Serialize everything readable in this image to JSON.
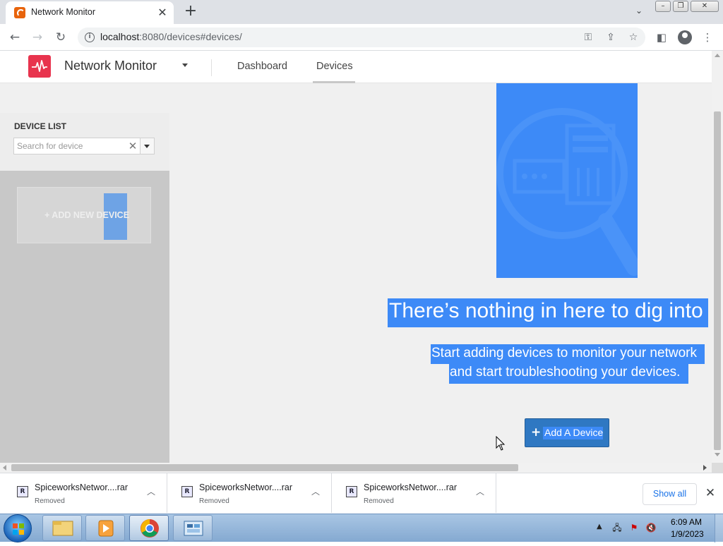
{
  "browser": {
    "tab_title": "Network Monitor",
    "url_host": "localhost",
    "url_rest": ":8080/devices#devices/"
  },
  "app": {
    "name": "Network Monitor",
    "brand_color": "#e8344e",
    "nav": [
      {
        "label": "Dashboard",
        "active": false
      },
      {
        "label": "Devices",
        "active": true
      }
    ]
  },
  "sidebar": {
    "title": "DEVICE LIST",
    "search_placeholder": "Search for device",
    "search_value": "",
    "add_new_label": "+ ADD NEW DEVICE"
  },
  "main": {
    "empty_title": "There’s nothing in here to dig into",
    "empty_subtitle_line1": "Start adding devices to monitor your network",
    "empty_subtitle_line2": "and start troubleshooting your devices.",
    "add_button_label": "Add A Device",
    "highlight_color": "#3d8af7"
  },
  "downloads": {
    "items": [
      {
        "name": "SpiceworksNetwor....rar",
        "status": "Removed"
      },
      {
        "name": "SpiceworksNetwor....rar",
        "status": "Removed"
      },
      {
        "name": "SpiceworksNetwor....rar",
        "status": "Removed"
      }
    ],
    "show_all_label": "Show all"
  },
  "taskbar": {
    "time": "6:09 AM",
    "date": "1/9/2023"
  }
}
